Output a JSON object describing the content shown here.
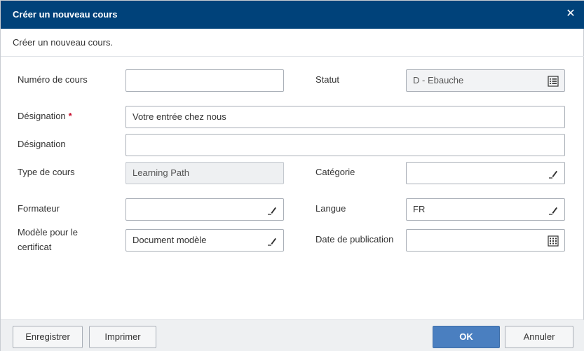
{
  "dialog": {
    "title": "Créer un nouveau cours",
    "close_symbol": "✕",
    "subtitle": "Créer un nouveau cours."
  },
  "form": {
    "numero_label": "Numéro de cours",
    "numero_value": "",
    "statut_label": "Statut",
    "statut_value": "D - Ebauche",
    "designation_label": "Désignation",
    "designation_required": "*",
    "designation_value": "Votre entrée chez nous",
    "designation2_label": "Désignation",
    "designation2_value": "",
    "type_label": "Type de cours",
    "type_value": "Learning Path",
    "categorie_label": "Catégorie",
    "categorie_value": "",
    "formateur_label": "Formateur",
    "formateur_value": "",
    "langue_label": "Langue",
    "langue_value": "FR",
    "modele_label_line1": "Modèle pour le",
    "modele_label_line2": "certificat",
    "modele_value": "Document modèle",
    "date_label": "Date de publication",
    "date_value": ""
  },
  "footer": {
    "save_label": "Enregistrer",
    "print_label": "Imprimer",
    "ok_label": "OK",
    "cancel_label": "Annuler"
  },
  "icons": {
    "list": "list-icon",
    "edit": "pencil-icon",
    "calendar": "calendar-icon",
    "close": "close-icon"
  },
  "colors": {
    "titlebar": "#00427a",
    "primary_button": "#4a7fc0",
    "required": "#c8102e"
  }
}
